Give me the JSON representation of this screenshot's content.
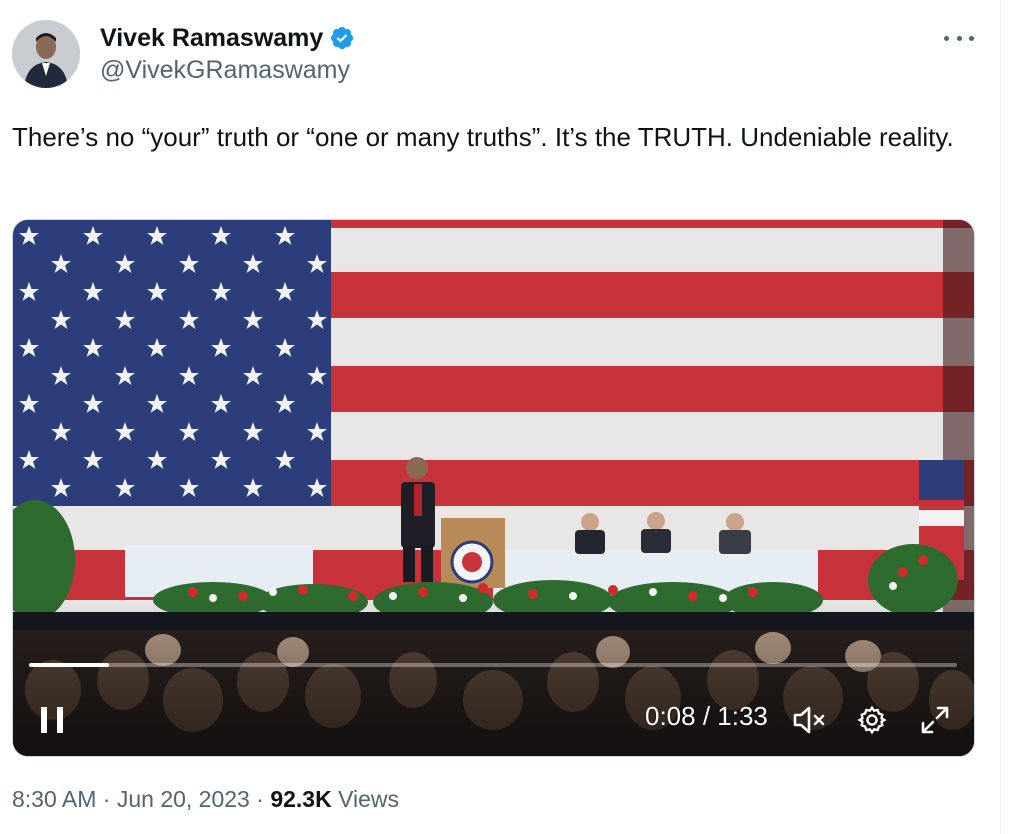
{
  "author": {
    "name": "Vivek Ramaswamy",
    "handle": "@VivekGRamaswamy",
    "verified": true
  },
  "tweet": {
    "text": "There’s no “your” truth or “one or many truths”. It’s the TRUTH. Undeniable reality."
  },
  "video": {
    "current_time": "0:08",
    "duration": "1:33",
    "time_display": "0:08 / 1:33",
    "progress": 0.086,
    "state": "playing",
    "muted": true
  },
  "meta": {
    "time": "8:30 AM",
    "separator": "·",
    "date": "Jun 20, 2023",
    "views_count": "92.3K",
    "views_label": "Views"
  },
  "colors": {
    "verified_blue": "#1d9bf0",
    "text_primary": "#0f1419",
    "text_secondary": "#536471",
    "flag_red": "#c8323a",
    "flag_blue": "#2b3d7a"
  },
  "icons": [
    "verified-badge-icon",
    "more-icon",
    "pause-icon",
    "mute-icon",
    "settings-icon",
    "fullscreen-icon"
  ]
}
